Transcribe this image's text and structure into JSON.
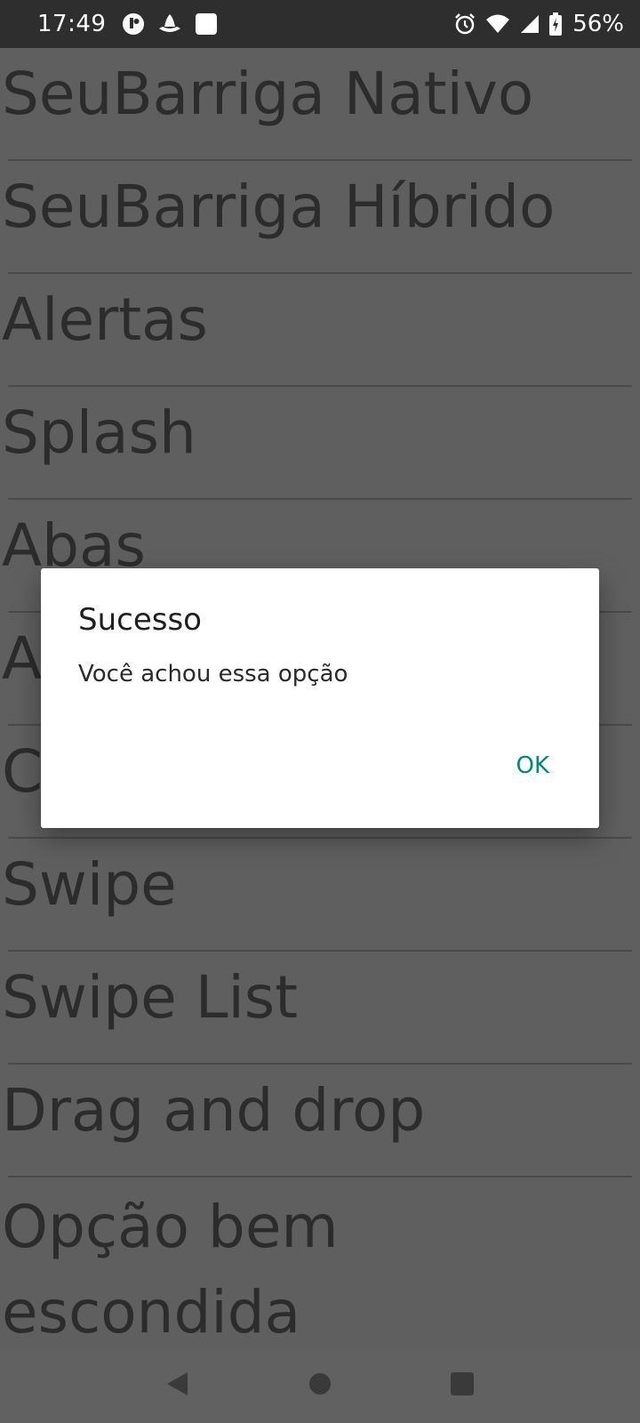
{
  "status_bar": {
    "time": "17:49",
    "battery_percent": "56%",
    "left_icons": [
      "app-notification-icon",
      "notification-icon",
      "square-notification-icon"
    ],
    "right_icons": [
      "alarm-icon",
      "wifi-icon",
      "cell-signal-icon",
      "battery-charging-icon"
    ]
  },
  "menu": {
    "items": [
      {
        "label": "SeuBarriga Nativo"
      },
      {
        "label": "SeuBarriga Híbrido"
      },
      {
        "label": "Alertas"
      },
      {
        "label": "Splash"
      },
      {
        "label": "Abas"
      },
      {
        "label": "A"
      },
      {
        "label": "C"
      },
      {
        "label": "Swipe"
      },
      {
        "label": "Swipe List"
      },
      {
        "label": "Drag and drop"
      },
      {
        "label": "Opção bem escondida"
      }
    ]
  },
  "dialog": {
    "title": "Sucesso",
    "message": "Você achou essa opção",
    "ok_label": "OK"
  },
  "nav_bar": {
    "buttons": [
      "back-icon",
      "home-icon",
      "recents-icon"
    ]
  },
  "colors": {
    "scrim_background": "#5f5f5f",
    "status_bar": "#2e2e2e",
    "accent": "#00897b",
    "dialog_background": "#ffffff"
  }
}
